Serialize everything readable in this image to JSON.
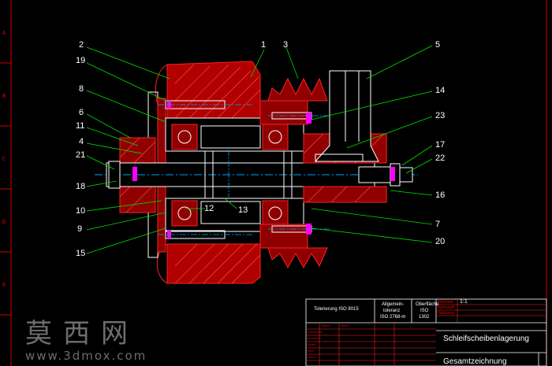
{
  "drawing": {
    "row_letters": [
      "A",
      "B",
      "C",
      "D",
      "E"
    ],
    "balloons": [
      "1",
      "2",
      "3",
      "4",
      "5",
      "6",
      "7",
      "8",
      "9",
      "10",
      "11",
      "12",
      "13",
      "14",
      "15",
      "16",
      "17",
      "18",
      "19",
      "20",
      "21",
      "22",
      "23"
    ]
  },
  "title_block": {
    "tolerance": "Tolerierung ISO 8015",
    "general_tol": [
      "Allgemein-",
      "toleranz",
      "ISO 2768-m"
    ],
    "surface": [
      "Oberfläche",
      "ISO",
      "1302"
    ],
    "scale_label": "Maßstab",
    "scale_value": "1:1",
    "title": "Schleifscheibenlagerung",
    "subtitle": "Gesamtzeichnung",
    "small_red": [
      "Werkstoff",
      "Halbzeug",
      "Rohteil-Nr",
      "Modell-Nr",
      "Datum",
      "Bearb",
      "Gepr",
      "Norm",
      "Name"
    ]
  },
  "watermark": {
    "chars": "莫西网",
    "url": "www.3dmox.com"
  }
}
